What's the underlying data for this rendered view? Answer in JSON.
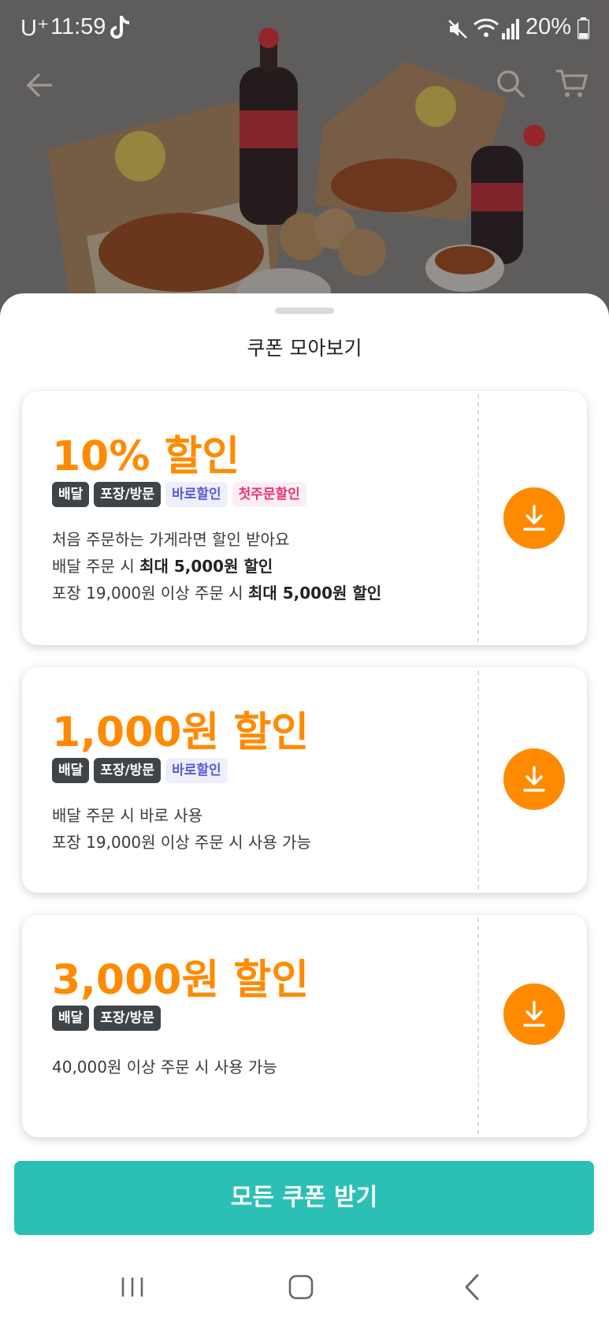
{
  "status_bar": {
    "carrier": "U⁺",
    "time": "11:59",
    "battery": "20%"
  },
  "sheet": {
    "title": "쿠폰 모아보기"
  },
  "coupons": [
    {
      "amount": "10% 할인",
      "tags": [
        {
          "label": "배달",
          "style": "dark"
        },
        {
          "label": "포장/방문",
          "style": "dark"
        },
        {
          "label": "바로할인",
          "style": "blue"
        },
        {
          "label": "첫주문할인",
          "style": "pink"
        }
      ],
      "lines": [
        {
          "text": "처음 주문하는 가게라면 할인 받아요",
          "bold": ""
        },
        {
          "text": "배달 주문 시 ",
          "bold": "최대 5,000원 할인"
        },
        {
          "text": "포장 19,000원 이상 주문 시 ",
          "bold": "최대 5,000원 할인"
        }
      ]
    },
    {
      "amount": "1,000원 할인",
      "tags": [
        {
          "label": "배달",
          "style": "dark"
        },
        {
          "label": "포장/방문",
          "style": "dark"
        },
        {
          "label": "바로할인",
          "style": "blue"
        }
      ],
      "lines": [
        {
          "text": "배달 주문 시 바로 사용",
          "bold": ""
        },
        {
          "text": "포장 19,000원 이상 주문 시 사용 가능",
          "bold": ""
        }
      ]
    },
    {
      "amount": "3,000원 할인",
      "tags": [
        {
          "label": "배달",
          "style": "dark"
        },
        {
          "label": "포장/방문",
          "style": "dark"
        }
      ],
      "lines": [
        {
          "text": "40,000원 이상 주문 시 사용 가능",
          "bold": ""
        }
      ]
    }
  ],
  "cta": {
    "label": "모든 쿠폰 받기"
  },
  "colors": {
    "accent": "#ff8a00",
    "cta": "#2bc0b5",
    "tag_dark": "#3f4448",
    "tag_blue_text": "#5a59d6",
    "tag_pink_text": "#e7337a"
  },
  "icons": {
    "download": "download-icon",
    "back": "arrow-left-icon",
    "search": "search-icon",
    "cart": "cart-icon"
  }
}
